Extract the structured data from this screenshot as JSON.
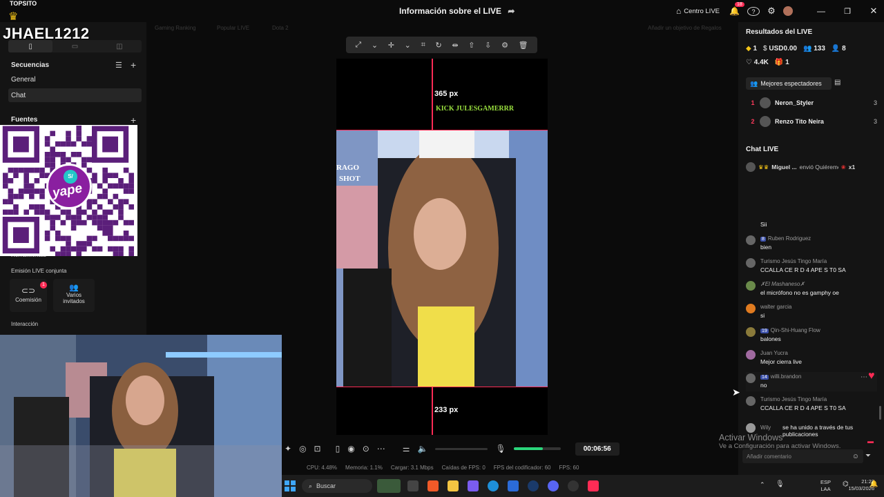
{
  "titlebar": {
    "brand": "TOPSITO",
    "center_title": "Información sobre el LIVE",
    "centro_live": "Centro LIVE",
    "notif_count": "18"
  },
  "overlay": {
    "username": "JHAEL1212"
  },
  "top_tags": {
    "gaming": "Gaming Ranking",
    "popular": "Popular LIVE",
    "dota": "Dota 2",
    "goal": "Añadir un objetivo de Regalos"
  },
  "left": {
    "sequences_title": "Secuencias",
    "items": [
      "General",
      "Chat"
    ],
    "sources_title": "Fuentes",
    "tools_title": "Herramientas",
    "joint_title": "Emisión LIVE conjunta",
    "coemision_label": "Coemisión",
    "coemision_badge": "1",
    "guests_label_1": "Varios",
    "guests_label_2": "invitados",
    "interaction_title": "Interacción"
  },
  "qr": {
    "brand": "yape",
    "currency": "S/"
  },
  "preview": {
    "top_px": "365 px",
    "banner": "KICK JULESGAMERRR",
    "side_text_1": "RAGO",
    "side_text_2": "SHOT",
    "bottom_px": "233 px"
  },
  "controls": {
    "timer": "00:06:56",
    "mic_level": 0.62
  },
  "stats": {
    "cpu": "CPU: 4.48%",
    "memory": "Memoria: 1.1%",
    "upload": "Cargar: 3.1 Mbps",
    "fps_drops": "Caídas de FPS: 0",
    "encoder_fps": "FPS del codificador: 60",
    "fps": "FPS: 60"
  },
  "results": {
    "title": "Resultados del LIVE",
    "diamonds": "1",
    "usd": "USD0.00",
    "viewers": "133",
    "new_followers": "8",
    "likes": "4.4K",
    "gifts": "1",
    "best_viewers_btn": "Mejores espectadores",
    "top_viewers": [
      {
        "rank": "1",
        "name": "Neron_Styler",
        "score": "3"
      },
      {
        "rank": "2",
        "name": "Renzo Tito Neira",
        "score": "3"
      }
    ]
  },
  "chat": {
    "title": "Chat LIVE",
    "gift_user": "Miguel ...",
    "gift_text": "envió Quiéreme",
    "gift_count": "x1",
    "messages": [
      {
        "user": "",
        "text": "Sii"
      },
      {
        "level": "8",
        "user": "Ruben Rodriguez",
        "text": "bien"
      },
      {
        "user": "Turismo Jesús Tingo María",
        "text": "CCALLA CE R D 4 APE S T0 SA"
      },
      {
        "user": "✗El Mashaneso✗",
        "text": "el micrófono no es gamphy oe"
      },
      {
        "user": "walter garcia",
        "text": "si"
      },
      {
        "level": "19",
        "user": "Qin-Shi-Huang Flow",
        "text": "balones"
      },
      {
        "user": "Juan Yucra",
        "text": "Mejor cierra live"
      },
      {
        "level": "14",
        "user": "willi.brandon",
        "text": "no"
      },
      {
        "user": "Turismo Jesús Tingo María",
        "text": "CCALLA CE R D 4 APE S T0 SA"
      },
      {
        "user": "Wily",
        "text": "se ha unido a través de tus publicaciones"
      }
    ],
    "comment_placeholder": "Añadir comentario"
  },
  "watermark": {
    "line1": "Activar Windows",
    "line2": "Ve a Configuración para activar Windows."
  },
  "taskbar": {
    "search": "Buscar",
    "lang_1": "ESP",
    "lang_2": "LAA",
    "time": "21:22",
    "date": "15/03/2026"
  }
}
